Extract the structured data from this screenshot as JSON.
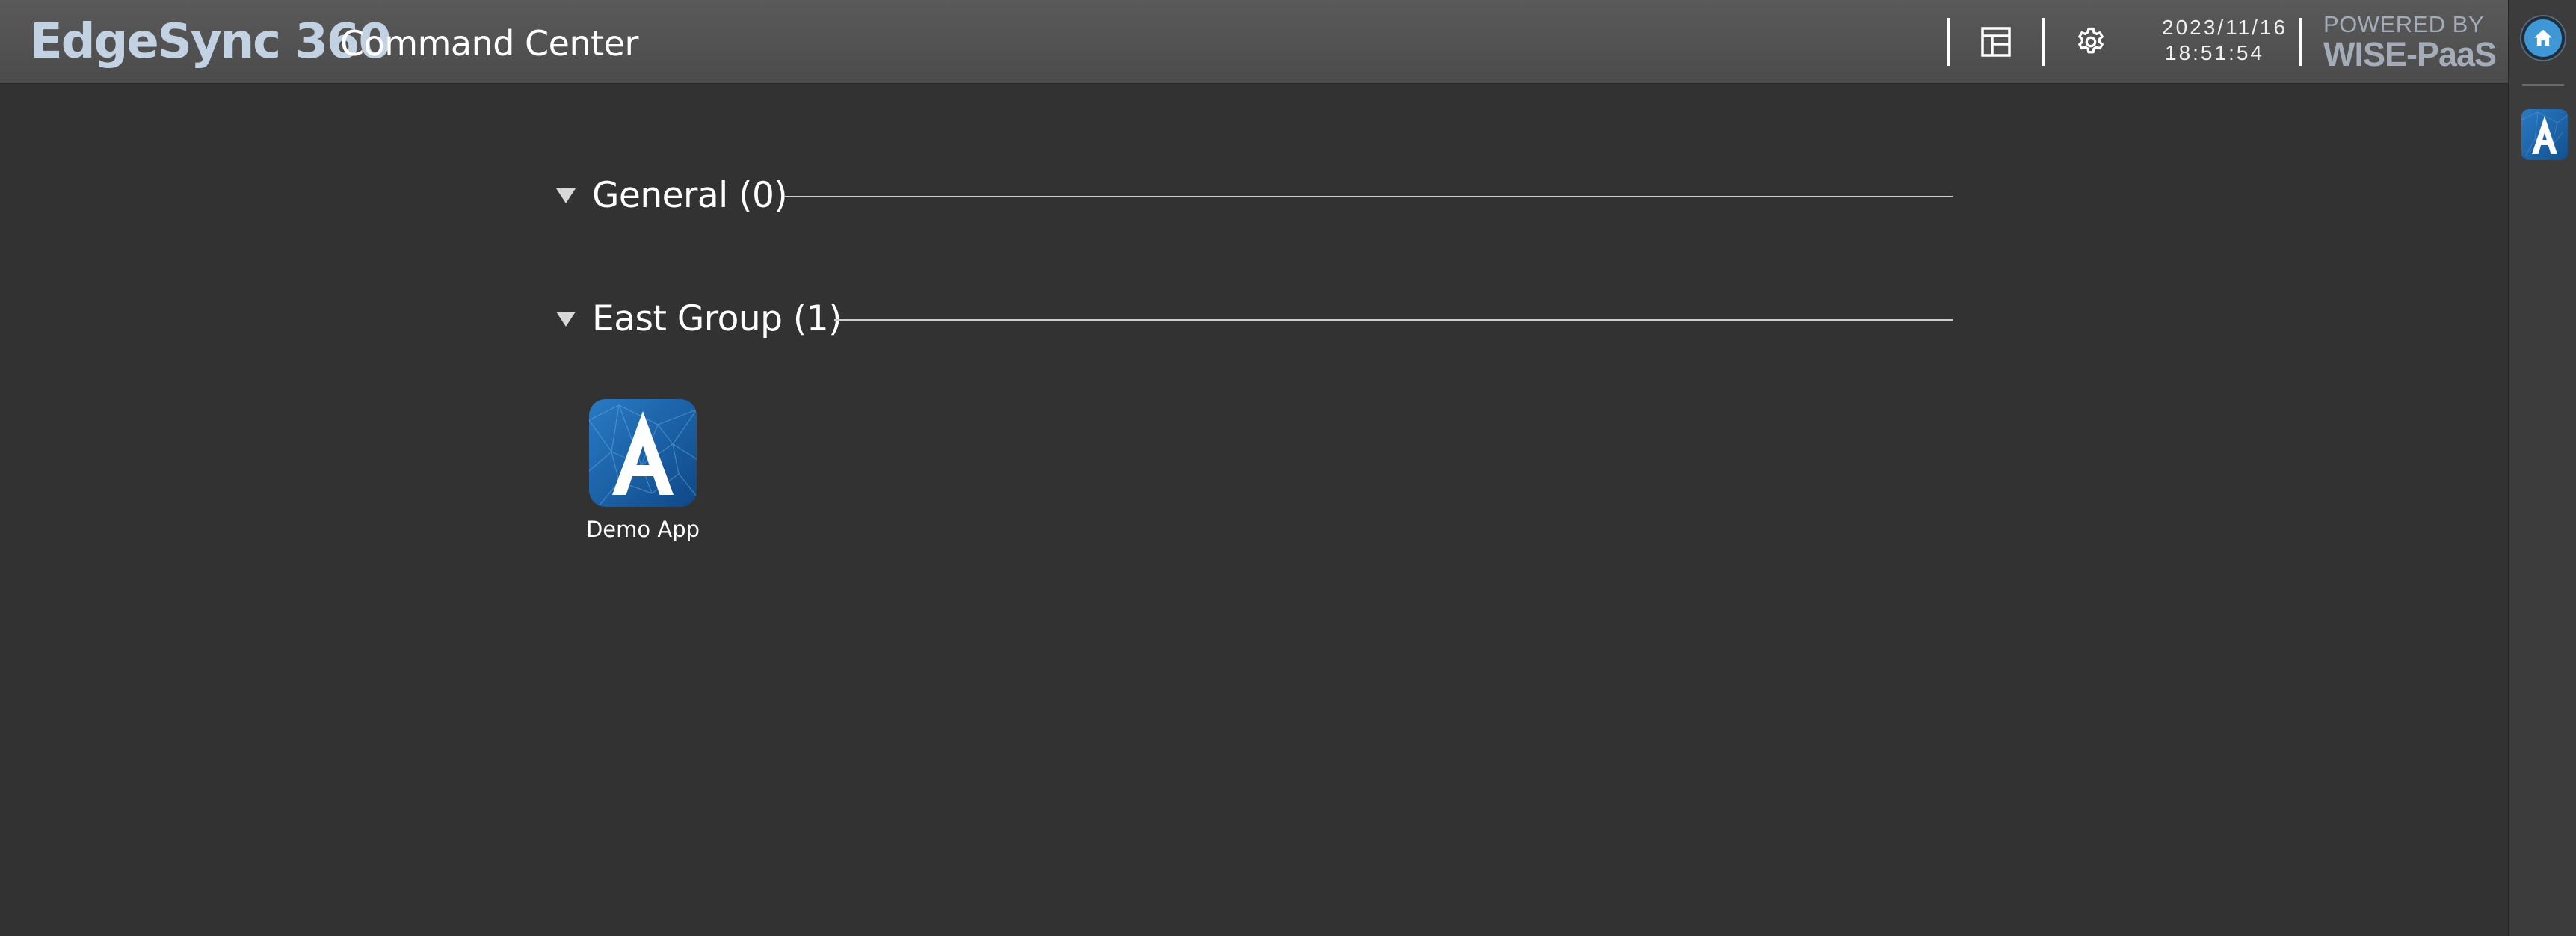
{
  "header": {
    "brand": "EdgeSync 360",
    "subtitle": "Command Center",
    "layout_icon": "layout-icon",
    "settings_icon": "gear-icon",
    "date": "2023/11/16",
    "time": "18:51:54",
    "powered_by": "POWERED BY",
    "platform": "WISE-PaaS"
  },
  "sidebar": {
    "home_icon": "home-icon",
    "app_icon": "app-a-icon"
  },
  "groups": [
    {
      "label": "General (0)",
      "expanded": true
    },
    {
      "label": "East Group (1)",
      "expanded": true
    }
  ],
  "apps": [
    {
      "label": "Demo App",
      "icon": "app-a-icon",
      "group": "East Group"
    }
  ],
  "colors": {
    "background": "#323232",
    "header": "#4b4b4b",
    "brand": "#c3d2e2",
    "accent": "#3f97d6",
    "app_icon": "#1a5fa3"
  }
}
